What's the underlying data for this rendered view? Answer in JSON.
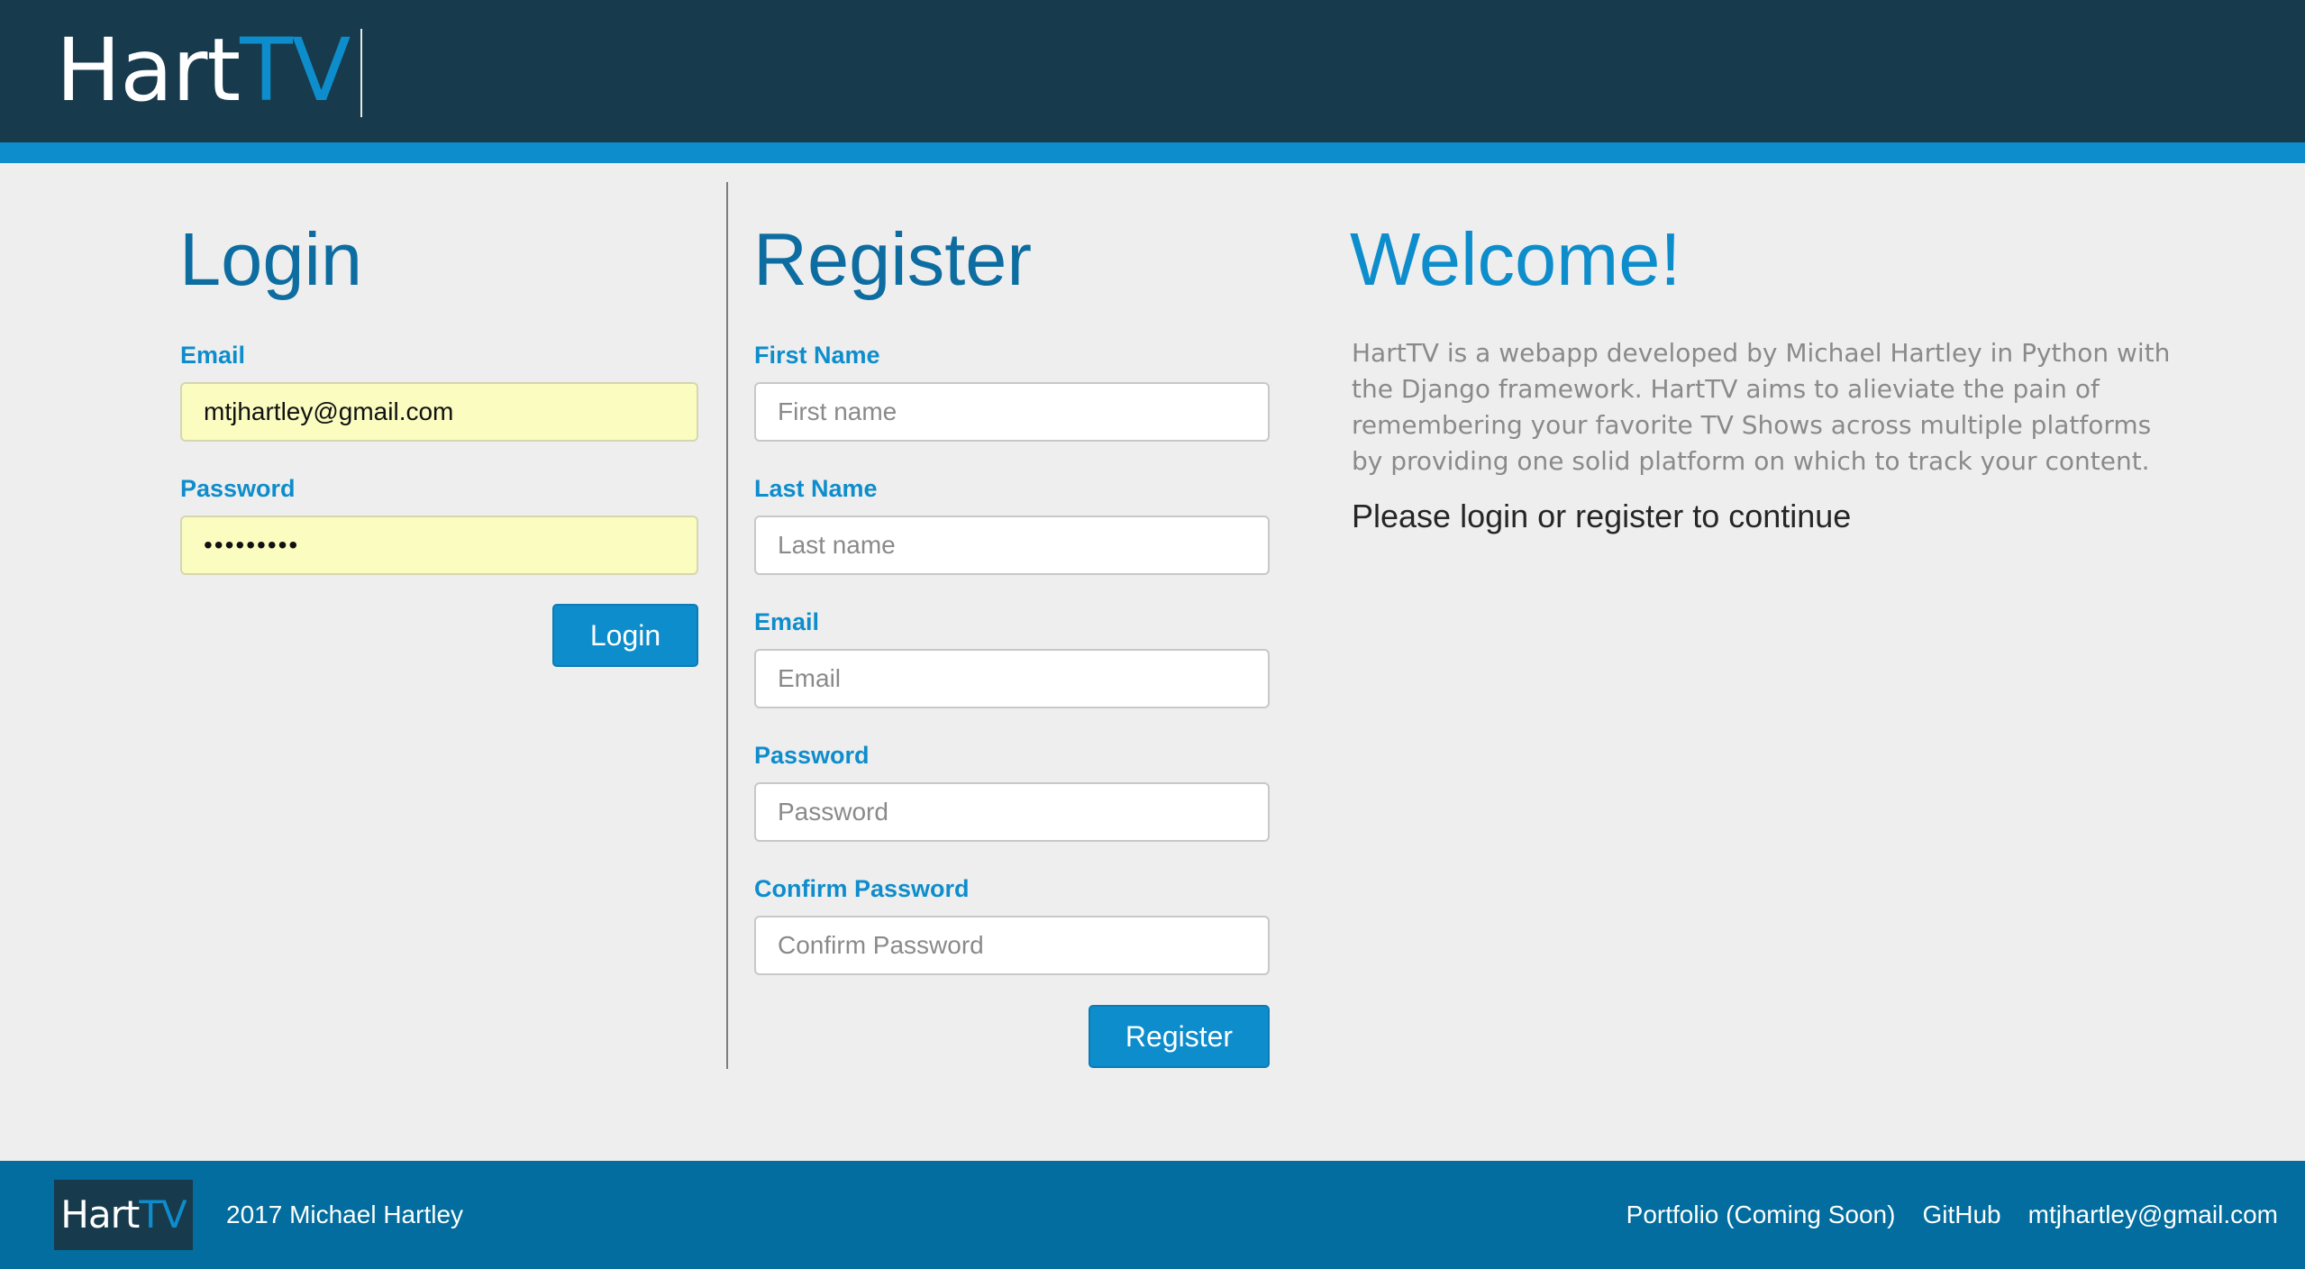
{
  "header": {
    "brand_prefix": "Hart",
    "brand_suffix": "TV"
  },
  "login": {
    "title": "Login",
    "email_label": "Email",
    "email_value": "mtjhartley@gmail.com",
    "password_label": "Password",
    "password_value": "•••••••••",
    "button_label": "Login"
  },
  "register": {
    "title": "Register",
    "first_name_label": "First Name",
    "first_name_placeholder": "First name",
    "last_name_label": "Last Name",
    "last_name_placeholder": "Last name",
    "email_label": "Email",
    "email_placeholder": "Email",
    "password_label": "Password",
    "password_placeholder": "Password",
    "confirm_label": "Confirm Password",
    "confirm_placeholder": "Confirm Password",
    "button_label": "Register"
  },
  "welcome": {
    "title": "Welcome!",
    "description": "HartTV is a webapp developed by Michael Hartley in Python with the Django framework. HartTV aims to alieviate the pain of remembering your favorite TV Shows across multiple platforms by providing one solid platform on which to track your content.",
    "prompt": "Please login or register to continue"
  },
  "footer": {
    "logo_prefix": "Hart",
    "logo_suffix": "TV",
    "copyright": "2017 Michael Hartley",
    "links": [
      "Portfolio (Coming Soon)",
      "GitHub",
      "mtjhartley@gmail.com"
    ]
  },
  "colors": {
    "header_bg": "#173a4c",
    "accent": "#0e8dcc",
    "heading_dark": "#0d6da1",
    "footer_bg": "#026d9e",
    "autofill_bg": "#fafcc0",
    "page_bg": "#eeeeee"
  }
}
